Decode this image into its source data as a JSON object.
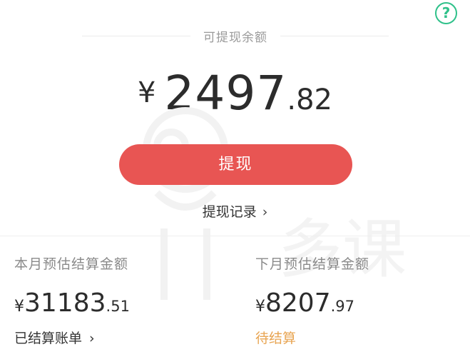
{
  "help": {
    "icon": "question-mark-icon",
    "glyph": "?",
    "color": "#2fc18a"
  },
  "header": {
    "title": "可提现余额"
  },
  "balance": {
    "currency": "¥",
    "integer": "2497",
    "decimal": ".82"
  },
  "withdraw": {
    "label": "提现",
    "color": "#e85553"
  },
  "record": {
    "label": "提现记录",
    "chevron": "›"
  },
  "this_month": {
    "label": "本月预估结算金额",
    "currency": "¥",
    "integer": "31183",
    "decimal": ".51",
    "link_label": "已结算账单",
    "chevron": "›"
  },
  "next_month": {
    "label": "下月预估结算金额",
    "currency": "¥",
    "integer": "8207",
    "decimal": ".97",
    "status_label": "待结算",
    "status_color": "#e8a451"
  },
  "watermark": {
    "text": "多课"
  }
}
